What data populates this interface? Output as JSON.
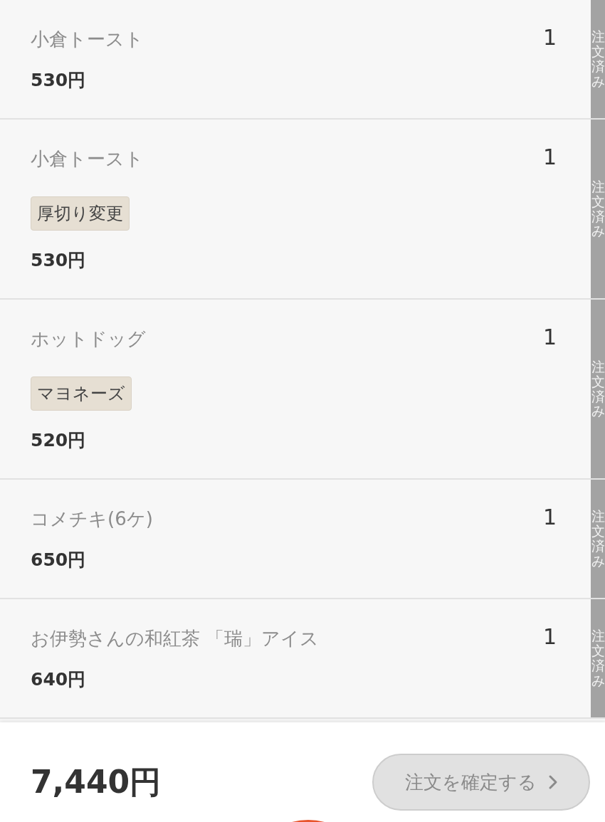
{
  "items": [
    {
      "name": "小倉トースト",
      "quantity": "1",
      "price": "530円",
      "status": "注文済み"
    },
    {
      "name": "小倉トースト",
      "quantity": "1",
      "options": [
        "厚切り変更"
      ],
      "price": "530円",
      "status": "注文済み"
    },
    {
      "name": "ホットドッグ",
      "quantity": "1",
      "options": [
        "マヨネーズ"
      ],
      "price": "520円",
      "status": "注文済み"
    },
    {
      "name": "コメチキ(6ケ)",
      "quantity": "1",
      "price": "650円",
      "status": "注文済み"
    },
    {
      "name": "お伊勢さんの和紅茶 「瑞」アイス",
      "quantity": "1",
      "price": "640円",
      "status": "注文済み"
    }
  ],
  "footer": {
    "total": "7,440円",
    "confirm_button": {
      "label": "注文を確定する",
      "disabled": true
    }
  }
}
